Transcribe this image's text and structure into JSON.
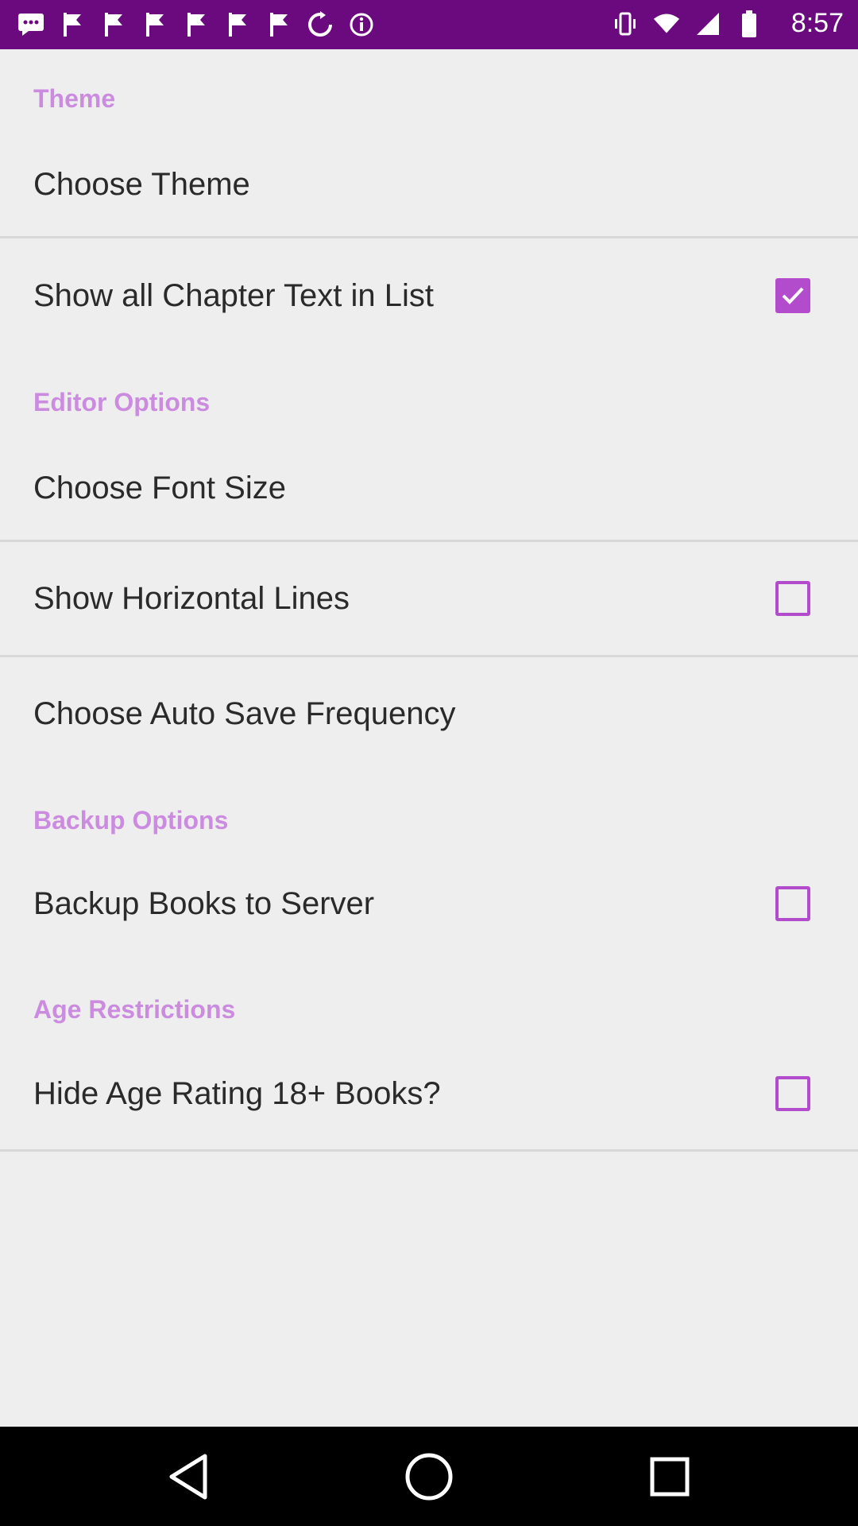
{
  "status_bar": {
    "time": "8:57",
    "left_icons": [
      "messages-icon",
      "flag-icon",
      "flag-icon",
      "flag-icon",
      "flag-icon",
      "flag-icon",
      "flag-icon",
      "sync-icon",
      "info-icon"
    ],
    "right_icons": [
      "vibrate-icon",
      "wifi-icon",
      "signal-icon",
      "battery-icon"
    ]
  },
  "sections": {
    "theme": {
      "header": "Theme",
      "choose_theme": "Choose Theme",
      "show_chapter_text": "Show all Chapter Text in List",
      "show_chapter_text_checked": true
    },
    "editor": {
      "header": "Editor Options",
      "font_size": "Choose Font Size",
      "horizontal_lines": "Show Horizontal Lines",
      "horizontal_lines_checked": false,
      "auto_save": "Choose Auto Save Frequency"
    },
    "backup": {
      "header": "Backup Options",
      "backup_books": "Backup Books to Server",
      "backup_books_checked": false
    },
    "age": {
      "header": "Age Restrictions",
      "hide_age_rating": "Hide Age Rating 18+ Books?",
      "hide_age_rating_checked": false
    }
  },
  "colors": {
    "status_bar": "#6a0a7e",
    "accent": "#b24ccd",
    "section_header": "#cb8ce0",
    "background": "#eeeeee"
  },
  "nav_bar": {
    "buttons": [
      "back-icon",
      "home-icon",
      "recents-icon"
    ]
  }
}
